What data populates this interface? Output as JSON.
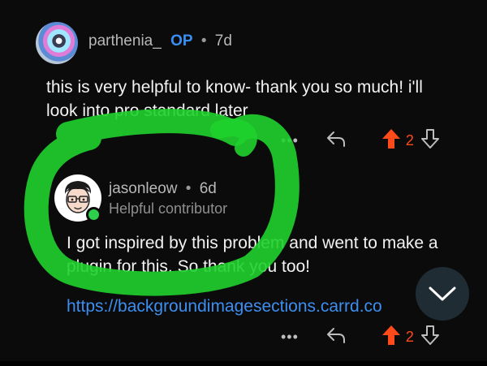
{
  "comments": [
    {
      "author": "parthenia_",
      "op_badge": "OP",
      "separator": "•",
      "age": "7d",
      "body": "this is very helpful to know- thank you so much! i'll look into pro standard later",
      "more_label": "•••",
      "votes": "2"
    },
    {
      "author": "jasonleow",
      "separator": "•",
      "age": "6d",
      "flair": "Helpful contributor",
      "body": "I got inspired by this problem and went to make a plugin for this. So thank you too!",
      "link": "https://backgroundimagesections.carrd.co",
      "more_label": "•••",
      "votes": "2"
    }
  ],
  "colors": {
    "upvote": "#ff4a1a",
    "op": "#3a8ff5",
    "link": "#3d8ef0",
    "highlight": "#1fd12c",
    "online": "#2ecf4b"
  },
  "icons": {
    "reply": "reply-arrow-icon",
    "upvote": "upvote-arrow-icon",
    "downvote": "downvote-arrow-icon",
    "scroll": "chevron-down-icon"
  }
}
